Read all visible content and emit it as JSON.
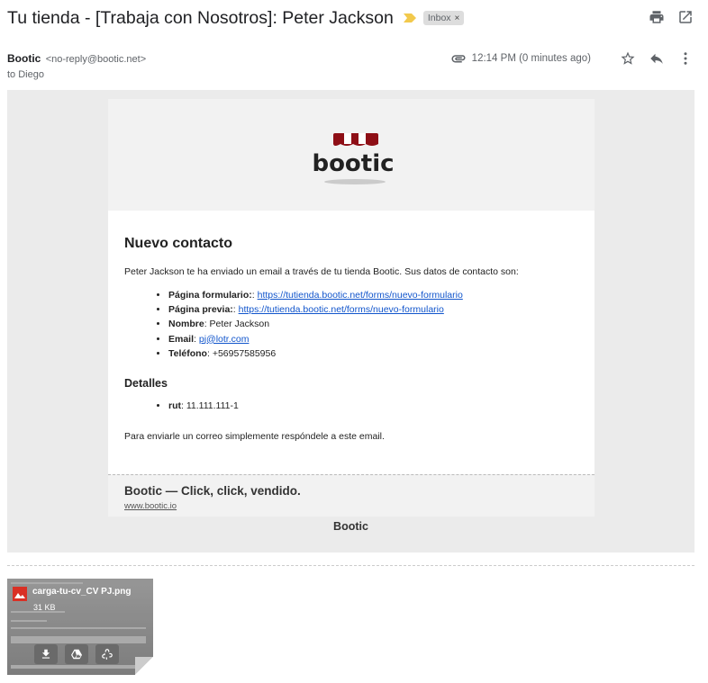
{
  "header": {
    "subject": "Tu tienda - [Trabaja con Nosotros]: Peter Jackson",
    "label": "Inbox",
    "label_remove": "×"
  },
  "sender": {
    "name": "Bootic",
    "email": "<no-reply@bootic.net>",
    "to": "to Diego",
    "time": "12:14 PM (0 minutes ago)"
  },
  "email": {
    "logo_text": "bootic",
    "title": "Nuevo contacto",
    "intro": "Peter Jackson te ha enviado un email a través de tu tienda Bootic. Sus datos de contacto son:",
    "fields": [
      {
        "label": "Página formulario:",
        "sep": ": ",
        "value": "https://tutienda.bootic.net/forms/nuevo-formulario",
        "link": true
      },
      {
        "label": "Página previa:",
        "sep": ": ",
        "value": "https://tutienda.bootic.net/forms/nuevo-formulario",
        "link": true
      },
      {
        "label": "Nombre",
        "sep": ": ",
        "value": "Peter Jackson",
        "link": false
      },
      {
        "label": "Email",
        "sep": ": ",
        "value": "pj@lotr.com",
        "link": true
      },
      {
        "label": "Teléfono",
        "sep": ": ",
        "value": "+56957585956",
        "link": false
      }
    ],
    "details_title": "Detalles",
    "details": [
      {
        "label": "rut",
        "sep": ": ",
        "value": "11.111.111-1"
      }
    ],
    "outro": "Para enviarle un correo simplemente respóndele a este email.",
    "footer_title": "Bootic — Click, click, vendido.",
    "footer_link": "www.bootic.io",
    "outer_brand": "Bootic"
  },
  "attachment": {
    "name": "carga-tu-cv_CV PJ.png",
    "size": "31 KB"
  },
  "colors": {
    "link": "#1155cc",
    "awning_red": "#8e0f16",
    "inbox_chip": "#dddddd",
    "email_bg": "#ebebeb"
  }
}
